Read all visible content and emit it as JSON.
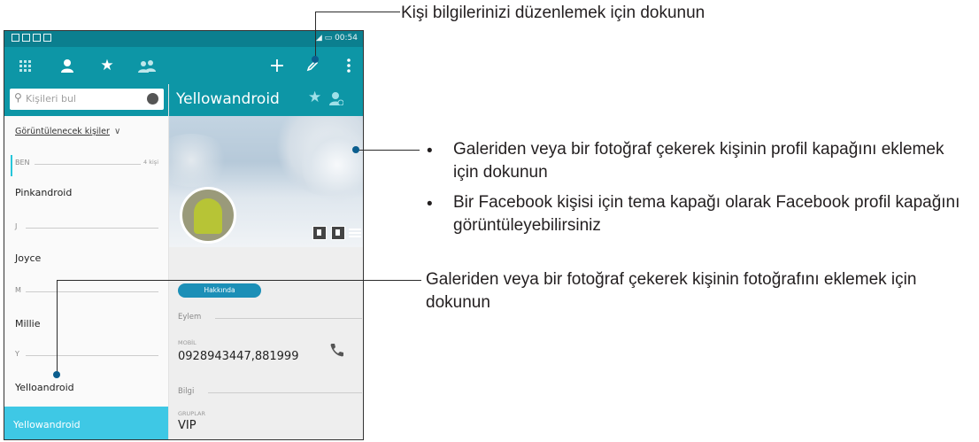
{
  "status_bar": {
    "time": "00:54"
  },
  "toolbar": {
    "icons": [
      "dialpad-icon",
      "person-icon",
      "star-icon",
      "groups-icon",
      "add-icon",
      "edit-icon",
      "overflow-menu-icon"
    ]
  },
  "search": {
    "placeholder": "Kişileri bul"
  },
  "filter": {
    "label": "Görüntülenecek kişiler"
  },
  "contacts": {
    "sections": [
      {
        "header": "BEN",
        "count": "4 kişi",
        "items": [
          "Pinkandroid"
        ]
      },
      {
        "header": "J",
        "items": [
          "Joyce"
        ]
      },
      {
        "header": "M",
        "items": [
          "Millie"
        ]
      },
      {
        "header": "Y",
        "items": [
          "Yelloandroid"
        ]
      }
    ],
    "selected": "Yellowandroid"
  },
  "detail": {
    "name": "Yellowandroid",
    "about_button": "Hakkında",
    "action_header": "Eylem",
    "phone_label": "MOBİL",
    "phone_value": "0928943447,881999",
    "info_header": "Bilgi",
    "groups_label": "GRUPLAR",
    "groups_value": "VIP"
  },
  "callouts": {
    "edit": "Kişi bilgilerinizi düzenlemek için dokunun",
    "cover_bullets": [
      "Galeriden veya bir fotoğraf çekerek kişinin profil kapağını eklemek için dokunun",
      "Bir Facebook kişisi için tema kapağı olarak Facebook profil kapağını görüntüleyebilirsiniz"
    ],
    "photo": "Galeriden veya bir fotoğraf çekerek kişinin fotoğrafını eklemek için dokunun"
  },
  "colors": {
    "teal_bar": "#0d96a6",
    "selected_row": "#3ec8e5",
    "callout_dot": "#0b5e8e"
  }
}
